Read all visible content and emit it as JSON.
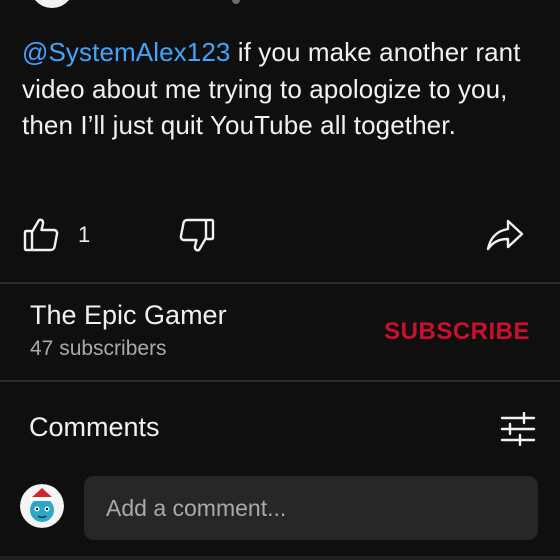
{
  "post": {
    "mention": "@SystemAlex123",
    "text": " if you make another rant video about me trying to apologize to you, then I’ll just quit YouTube all together.",
    "like_count": "1"
  },
  "channel": {
    "name": "The Epic Gamer",
    "subscribers": "47 subscribers",
    "subscribe_label": "SUBSCRIBE"
  },
  "comments": {
    "title": "Comments",
    "input_placeholder": "Add a comment..."
  },
  "icons": {
    "like": "thumbs-up-icon",
    "dislike": "thumbs-down-icon",
    "share": "share-arrow-icon",
    "sort": "sliders-icon"
  },
  "colors": {
    "background": "#0f0f0f",
    "text": "#f1f1f1",
    "secondary_text": "#aaaaaa",
    "mention": "#3ea6ff",
    "subscribe": "#cc0f2f",
    "input_background": "#272727"
  }
}
